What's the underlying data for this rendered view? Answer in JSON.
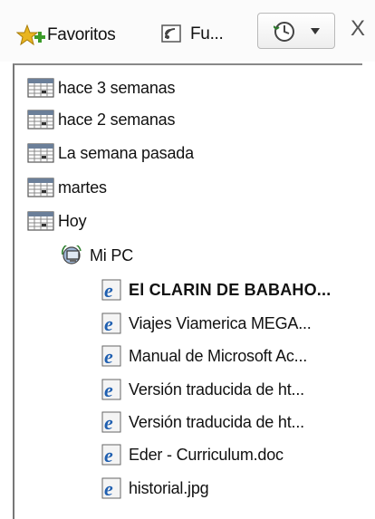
{
  "toolbar": {
    "favorites_label": "Favoritos",
    "feeds_label": "Fu...",
    "close_label": "X"
  },
  "history": {
    "groups": [
      {
        "label": "hace 3 semanas"
      },
      {
        "label": "hace 2 semanas"
      },
      {
        "label": "La semana pasada"
      },
      {
        "label": "martes"
      },
      {
        "label": "Hoy"
      }
    ],
    "site": {
      "label": "Mi PC"
    },
    "items": [
      {
        "label": "El CLARIN DE BABAHO..."
      },
      {
        "label": "Viajes Viamerica MEGA..."
      },
      {
        "label": "Manual de Microsoft Ac..."
      },
      {
        "label": "Versión traducida de ht..."
      },
      {
        "label": "Versión traducida de ht..."
      },
      {
        "label": "Eder - Curriculum.doc"
      },
      {
        "label": "historial.jpg"
      }
    ]
  },
  "colors": {
    "star": "#e8b520",
    "ie_blue": "#1f5fb0",
    "calendar_header": "#6b7f99"
  }
}
